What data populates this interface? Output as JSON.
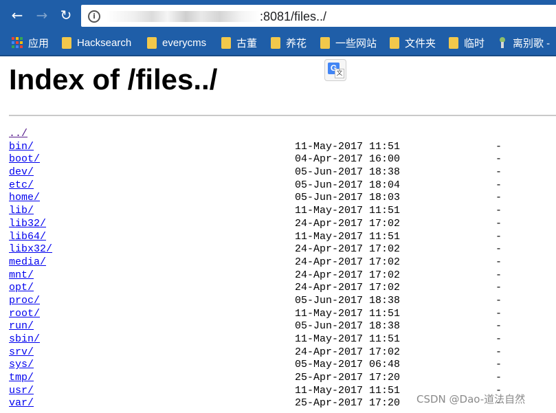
{
  "browser": {
    "url_suffix": ":8081/files../",
    "bookmarks": [
      {
        "label": "应用",
        "icon": "apps-icon"
      },
      {
        "label": "Hacksearch",
        "icon": "folder-icon"
      },
      {
        "label": "everycms",
        "icon": "folder-icon"
      },
      {
        "label": "古董",
        "icon": "folder-icon"
      },
      {
        "label": "养花",
        "icon": "folder-icon"
      },
      {
        "label": "一些网站",
        "icon": "folder-icon"
      },
      {
        "label": "文件夹",
        "icon": "folder-icon"
      },
      {
        "label": "临时",
        "icon": "folder-icon"
      },
      {
        "label": "离别歌 -",
        "icon": "bookmark-favicon-icon"
      }
    ]
  },
  "page": {
    "title": "Index of /files../",
    "parent_link": "../",
    "entries": [
      {
        "name": "bin/",
        "date": "11-May-2017 11:51",
        "size": "-"
      },
      {
        "name": "boot/",
        "date": "04-Apr-2017 16:00",
        "size": "-"
      },
      {
        "name": "dev/",
        "date": "05-Jun-2017 18:38",
        "size": "-"
      },
      {
        "name": "etc/",
        "date": "05-Jun-2017 18:04",
        "size": "-"
      },
      {
        "name": "home/",
        "date": "05-Jun-2017 18:03",
        "size": "-"
      },
      {
        "name": "lib/",
        "date": "11-May-2017 11:51",
        "size": "-"
      },
      {
        "name": "lib32/",
        "date": "24-Apr-2017 17:02",
        "size": "-"
      },
      {
        "name": "lib64/",
        "date": "11-May-2017 11:51",
        "size": "-"
      },
      {
        "name": "libx32/",
        "date": "24-Apr-2017 17:02",
        "size": "-"
      },
      {
        "name": "media/",
        "date": "24-Apr-2017 17:02",
        "size": "-"
      },
      {
        "name": "mnt/",
        "date": "24-Apr-2017 17:02",
        "size": "-"
      },
      {
        "name": "opt/",
        "date": "24-Apr-2017 17:02",
        "size": "-"
      },
      {
        "name": "proc/",
        "date": "05-Jun-2017 18:38",
        "size": "-"
      },
      {
        "name": "root/",
        "date": "11-May-2017 11:51",
        "size": "-"
      },
      {
        "name": "run/",
        "date": "05-Jun-2017 18:38",
        "size": "-"
      },
      {
        "name": "sbin/",
        "date": "11-May-2017 11:51",
        "size": "-"
      },
      {
        "name": "srv/",
        "date": "24-Apr-2017 17:02",
        "size": "-"
      },
      {
        "name": "sys/",
        "date": "05-May-2017 06:48",
        "size": "-"
      },
      {
        "name": "tmp/",
        "date": "25-Apr-2017 17:20",
        "size": "-"
      },
      {
        "name": "usr/",
        "date": "11-May-2017 11:51",
        "size": "-"
      },
      {
        "name": "var/",
        "date": "25-Apr-2017 17:20",
        "size": "-"
      }
    ]
  },
  "watermark": "CSDN @Dao-道法自然",
  "colors": {
    "chrome": "#1f5ea8",
    "link": "#0000ee",
    "visited_link": "#551a8b"
  }
}
